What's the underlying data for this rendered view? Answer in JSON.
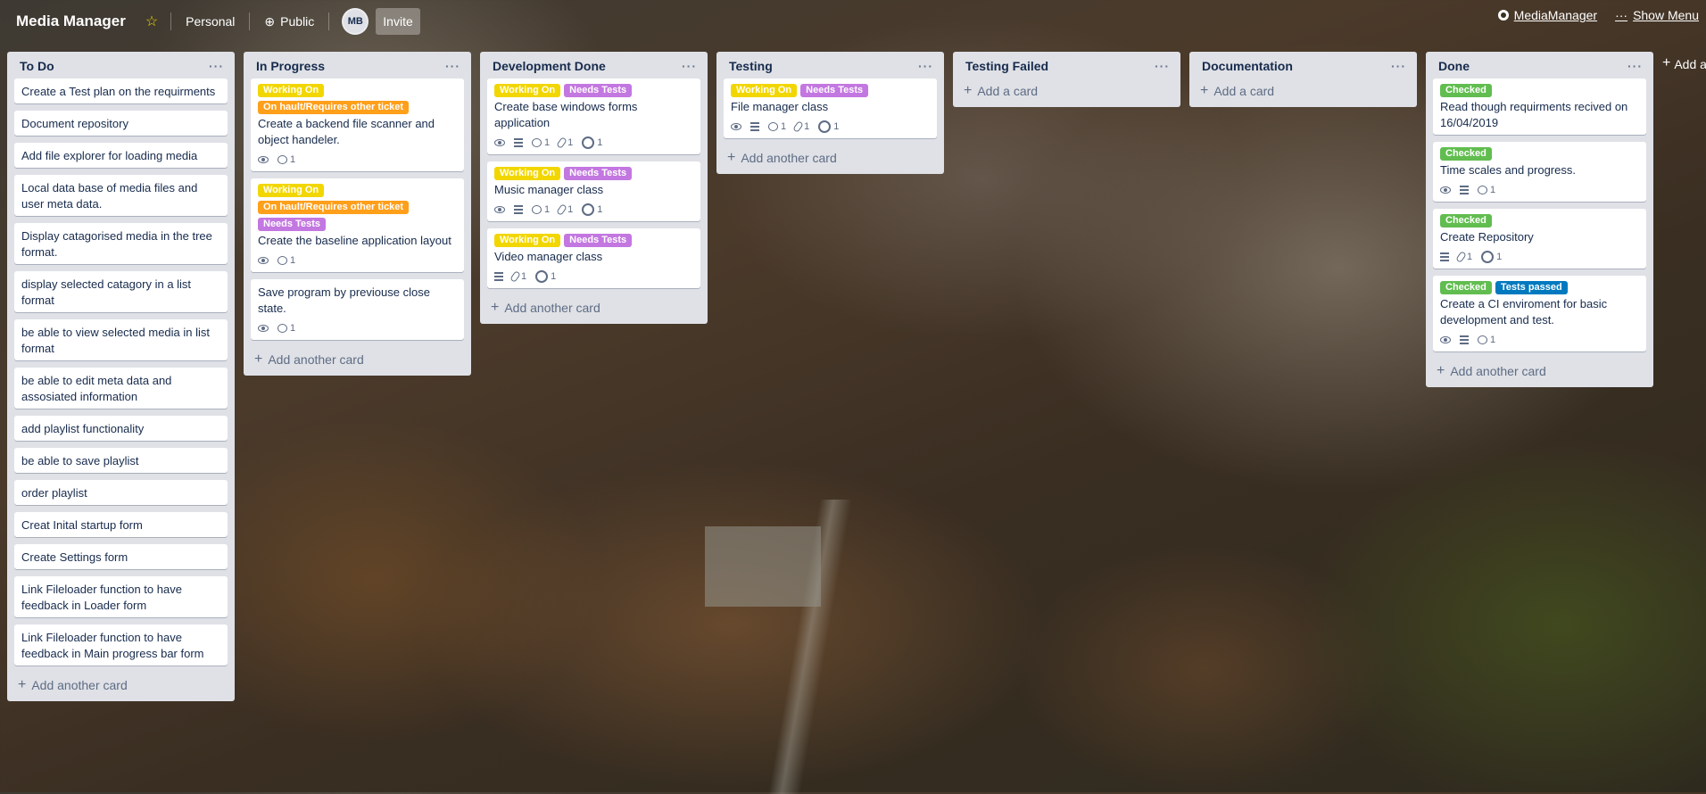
{
  "header": {
    "board_title": "Media Manager",
    "star_icon": "star-icon",
    "visibility_team": "Personal",
    "visibility_public": "Public",
    "avatar_initials": "MB",
    "invite_label": "Invite",
    "power_up_link": "MediaManager",
    "show_menu": "Show Menu"
  },
  "colors": {
    "yellow": "#f2d600",
    "orange": "#ff9f1a",
    "purple": "#c377e0",
    "green": "#61bd4f",
    "blue": "#0079bf"
  },
  "add_card_label": "Add another card",
  "add_a_card_label": "Add a card",
  "add_list_label": "Add another list",
  "lists": [
    {
      "title": "To Do",
      "cards": [
        "Create a Test plan on the requirments",
        "Document repository",
        "Add file explorer for loading media",
        "Local data base of media files and user meta data.",
        "Display catagorised media in the tree format.",
        "display selected catagory in a list format",
        "be able to view selected media in list format",
        "be able to edit meta data and assosiated information",
        "add playlist functionality",
        "be able to save playlist",
        "order playlist",
        "Creat Inital startup form",
        "Create Settings form",
        "Link Fileloader function to have feedback in Loader form",
        "Link Fileloader function to have feedback in Main progress bar form"
      ]
    },
    {
      "title": "In Progress",
      "cards": [
        {
          "labels": [
            "Working On",
            "On hault/Requires other ticket"
          ],
          "text": "Create a backend file scanner and object handeler.",
          "badges": {
            "watch": true,
            "comments": "1"
          }
        },
        {
          "labels": [
            "Working On",
            "On hault/Requires other ticket",
            "Needs Tests"
          ],
          "text": "Create the baseline application layout",
          "badges": {
            "watch": true,
            "comments": "1"
          }
        },
        {
          "labels": [],
          "text": "Save program by previouse close state.",
          "badges": {
            "watch": true,
            "comments": "1"
          }
        }
      ]
    },
    {
      "title": "Development Done",
      "cards": [
        {
          "labels": [
            "Working On",
            "Needs Tests"
          ],
          "text": "Create base windows forms application",
          "badges": {
            "watch": true,
            "desc": true,
            "comments": "1",
            "attachments": "1",
            "github": "1"
          }
        },
        {
          "labels": [
            "Working On",
            "Needs Tests"
          ],
          "text": "Music manager class",
          "badges": {
            "watch": true,
            "desc": true,
            "comments": "1",
            "attachments": "1",
            "github": "1"
          }
        },
        {
          "labels": [
            "Working On",
            "Needs Tests"
          ],
          "text": "Video manager class",
          "badges": {
            "desc": true,
            "attachments": "1",
            "github": "1"
          }
        }
      ]
    },
    {
      "title": "Testing",
      "cards": [
        {
          "labels": [
            "Working On",
            "Needs Tests"
          ],
          "text": "File manager class",
          "badges": {
            "watch": true,
            "desc": true,
            "comments": "1",
            "attachments": "1",
            "github": "1"
          }
        }
      ]
    },
    {
      "title": "Testing Failed",
      "cards": []
    },
    {
      "title": "Documentation",
      "cards": []
    },
    {
      "title": "Done",
      "cards": [
        {
          "labels": [
            "Checked"
          ],
          "text": "Read though requirments recived on 16/04/2019",
          "badges": {}
        },
        {
          "labels": [
            "Checked"
          ],
          "text": "Time scales and progress.",
          "badges": {
            "watch": true,
            "desc": true,
            "comments": "1"
          }
        },
        {
          "labels": [
            "Checked"
          ],
          "text": "Create Repository",
          "badges": {
            "desc": true,
            "attachments": "1",
            "github": "1"
          }
        },
        {
          "labels": [
            "Checked",
            "Tests passed"
          ],
          "text": "Create a CI enviroment for basic development and test.",
          "badges": {
            "watch": true,
            "desc": true,
            "comments": "1"
          }
        }
      ]
    }
  ]
}
